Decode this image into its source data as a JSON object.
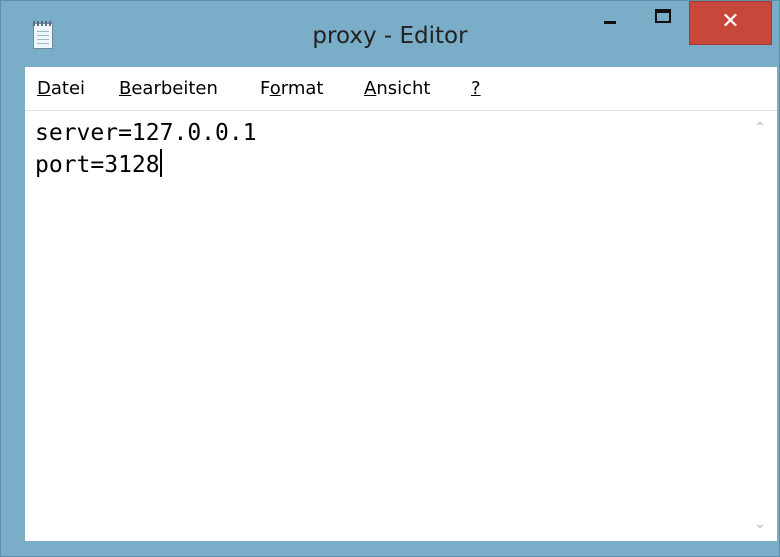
{
  "window": {
    "title": "proxy - Editor",
    "icon": "notepad-icon",
    "controls": {
      "minimize_icon": "minimize-icon",
      "maximize_icon": "maximize-icon",
      "close_glyph": "✕"
    }
  },
  "menu": {
    "items": [
      {
        "prefix": "",
        "accel": "D",
        "suffix": "atei"
      },
      {
        "prefix": "",
        "accel": "B",
        "suffix": "earbeiten"
      },
      {
        "prefix": "F",
        "accel": "o",
        "suffix": "rmat"
      },
      {
        "prefix": "",
        "accel": "A",
        "suffix": "nsicht"
      },
      {
        "prefix": "",
        "accel": "?",
        "suffix": ""
      }
    ]
  },
  "editor": {
    "lines": [
      "server=127.0.0.1",
      "port=3128"
    ]
  },
  "scrollbar": {
    "up_glyph": "⌃",
    "down_glyph": "⌄"
  },
  "colors": {
    "frame": "#7aaec8",
    "close_button": "#c7473b"
  }
}
